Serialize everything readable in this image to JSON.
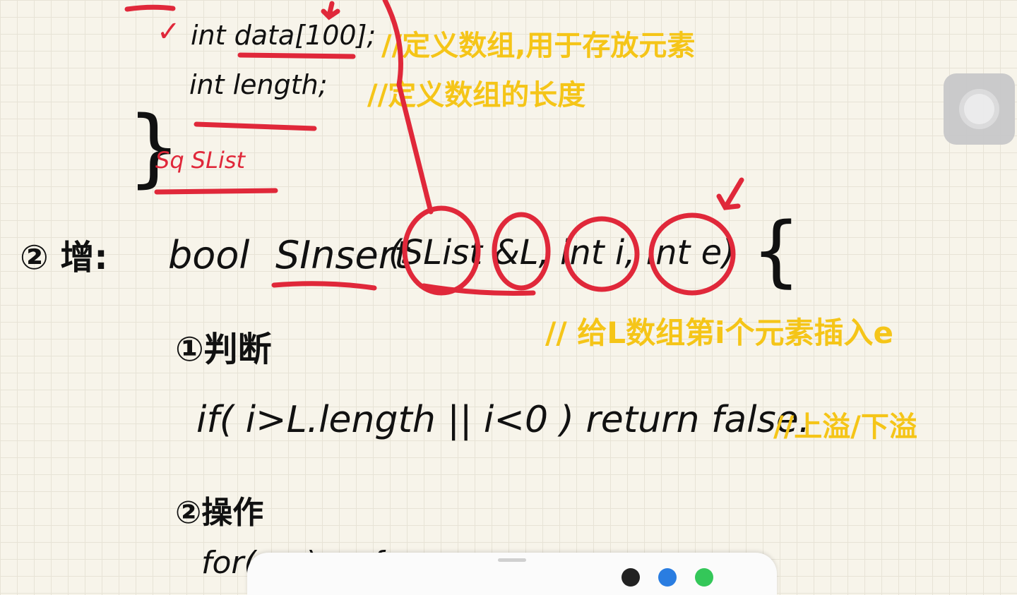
{
  "code": {
    "line1": "int data[100];",
    "line2": "int length;",
    "struct_name": "Sq SList",
    "step_label": "② 增:",
    "signature_return": "bool",
    "signature_fn": "SInsert",
    "signature_params": "(SList &L, int i, int e)",
    "brace": "{",
    "sub1": "①判断",
    "cond": "if( i>L.length || i<0 ) return false.",
    "sub2": "②操作",
    "line_partial": "for( ... ) ... {"
  },
  "notes": {
    "n1": "//定义数组,用于存放元素",
    "n2": "//定义数组的长度",
    "n3": "// 给L数组第i个元素插入e",
    "n4": "//上溢/下溢"
  },
  "colors": {
    "ink": "#111111",
    "red": "#e0283a",
    "highlight": "#f5c518"
  },
  "icons": {
    "assistive": "assistive-touch-icon"
  }
}
